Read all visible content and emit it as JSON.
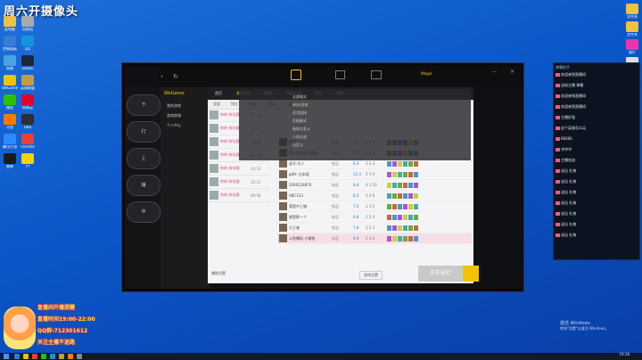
{
  "stream_title": "周六开摄像头",
  "desktop_icons_left": [
    {
      "label": "此电脑",
      "color": "#f0c040"
    },
    {
      "label": "回收站",
      "color": "#aaa"
    },
    {
      "label": "控制面板",
      "color": "#3a7bd5"
    },
    {
      "label": "QQ",
      "color": "#1296db"
    },
    {
      "label": "网络",
      "color": "#4aa3df"
    },
    {
      "label": "Steam",
      "color": "#1b2838"
    },
    {
      "label": "WeGame",
      "color": "#f2c300"
    },
    {
      "label": "英雄联盟",
      "color": "#c89b3c"
    },
    {
      "label": "微信",
      "color": "#2dc100"
    },
    {
      "label": "网易云",
      "color": "#e60026"
    },
    {
      "label": "斗鱼",
      "color": "#ff7a00"
    },
    {
      "label": "OBS",
      "color": "#302e31"
    },
    {
      "label": "腾讯手游",
      "color": "#2b8cff"
    },
    {
      "label": "Chrome",
      "color": "#e94235"
    },
    {
      "label": "雷神",
      "color": "#1a1a1a"
    },
    {
      "label": "YY",
      "color": "#ffd200"
    }
  ],
  "desktop_icons_right": [
    {
      "label": "文件夹",
      "color": "#f0c040"
    },
    {
      "label": "文件夹",
      "color": "#f0c040"
    },
    {
      "label": "图片",
      "color": "#e3a",
      "color2": ""
    },
    {
      "label": "新建文本",
      "color": "#ddd"
    },
    {
      "label": "文件夹",
      "color": "#f0c040"
    },
    {
      "label": "直播",
      "color": "#ff5a7a"
    }
  ],
  "left_panel": {
    "items": [
      "下",
      "打",
      "上",
      "辅",
      "中"
    ]
  },
  "wegame": {
    "title": "WeGame",
    "nav_items": [
      "我的游戏",
      "游戏商城",
      "个人中心"
    ],
    "user": "Wegal"
  },
  "app": {
    "tabs": [
      "首页",
      "我的战绩",
      "数据",
      "英雄大全",
      "发现",
      "商城"
    ],
    "sub_tabs": [
      "全部",
      "排位",
      "匹配",
      "大乱斗",
      "云顶之弈"
    ],
    "dropdown": [
      "全部模式",
      "单排/双排",
      "灵活组排",
      "匹配模式",
      "极地大乱斗",
      "人机对战",
      "自定义"
    ],
    "players": [
      {
        "name": "你的-排位赛",
        "time": "11:42"
      },
      {
        "name": "你的-排位赛",
        "time": "11:30"
      },
      {
        "name": "你的-排位赛",
        "time": "11:05"
      },
      {
        "name": "你的-排位赛",
        "time": "10:51"
      },
      {
        "name": "你的-排位赛",
        "time": "10:33"
      },
      {
        "name": "你的-排位赛",
        "time": "10:12"
      },
      {
        "name": "你的-排位赛",
        "time": "09:58"
      }
    ],
    "rows": [
      {
        "name": "我是",
        "rank": "钻石",
        "kda": "7.9",
        "score": "3 1 6"
      },
      {
        "name": "第一次用这个组合",
        "rank": "钻石",
        "kda": "9.1",
        "score": "4 2 5"
      },
      {
        "name": "虎牙·凡人",
        "rank": "钻石",
        "kda": "8.4",
        "score": "3 2 4"
      },
      {
        "name": "gdH- 白米饭",
        "rank": "钻石",
        "kda": "13.3",
        "score": "5 1 9"
      },
      {
        "name": "2000124874",
        "rank": "钻石",
        "kda": "8.4",
        "score": "4 1 10"
      },
      {
        "name": "ABC123",
        "rank": "钻石",
        "kda": "8.5",
        "score": "3 2 6"
      },
      {
        "name": "我是中上铺",
        "rank": "钻石",
        "kda": "7.0",
        "score": "2 3 5"
      },
      {
        "name": "就是那一个",
        "rank": "钻石",
        "kda": "6.8",
        "score": "2 2 4"
      },
      {
        "name": "大王者",
        "rank": "钻石",
        "kda": "7.8",
        "score": "3 2 3"
      },
      {
        "name": "斗鱼爆料 小钢铁",
        "rank": "钻石",
        "kda": "4.9",
        "score": "1 3 4"
      }
    ],
    "run_button": "正在运行",
    "bottom_left": "辅助设置",
    "bottom_select": "游戏设置"
  },
  "chat": {
    "title": "弹幕助手",
    "lines": [
      {
        "nick": "",
        "msg": "欢迎来到直播间"
      },
      {
        "nick": "",
        "msg": "送给主播 弹幕"
      },
      {
        "nick": "",
        "msg": "欢迎来到直播间"
      },
      {
        "nick": "",
        "msg": "欢迎来到直播间"
      },
      {
        "nick": "",
        "msg": "主播好强"
      },
      {
        "nick": "",
        "msg": "这个英雄怎么玩"
      },
      {
        "nick": "",
        "msg": "66666"
      },
      {
        "nick": "",
        "msg": "冲冲冲"
      },
      {
        "nick": "",
        "msg": "主播加油"
      },
      {
        "nick": "",
        "msg": "送出 礼物"
      },
      {
        "nick": "",
        "msg": "送出 礼物"
      },
      {
        "nick": "",
        "msg": "送出 礼物"
      },
      {
        "nick": "",
        "msg": "送出 礼物"
      },
      {
        "nick": "",
        "msg": "送出 礼物"
      },
      {
        "nick": "",
        "msg": "送出 礼物"
      },
      {
        "nick": "",
        "msg": "送出 礼物"
      }
    ]
  },
  "banner": {
    "lines": [
      "直播间开播提醒",
      "直播时间19:00-22:00",
      "QQ群:712301612",
      "关注主播不迷路"
    ]
  },
  "windows": {
    "activate_1": "激活 Windows",
    "activate_2": "转到\"设置\"以激活 Windows。",
    "time": "19:38",
    "date": "2023/1/14"
  }
}
